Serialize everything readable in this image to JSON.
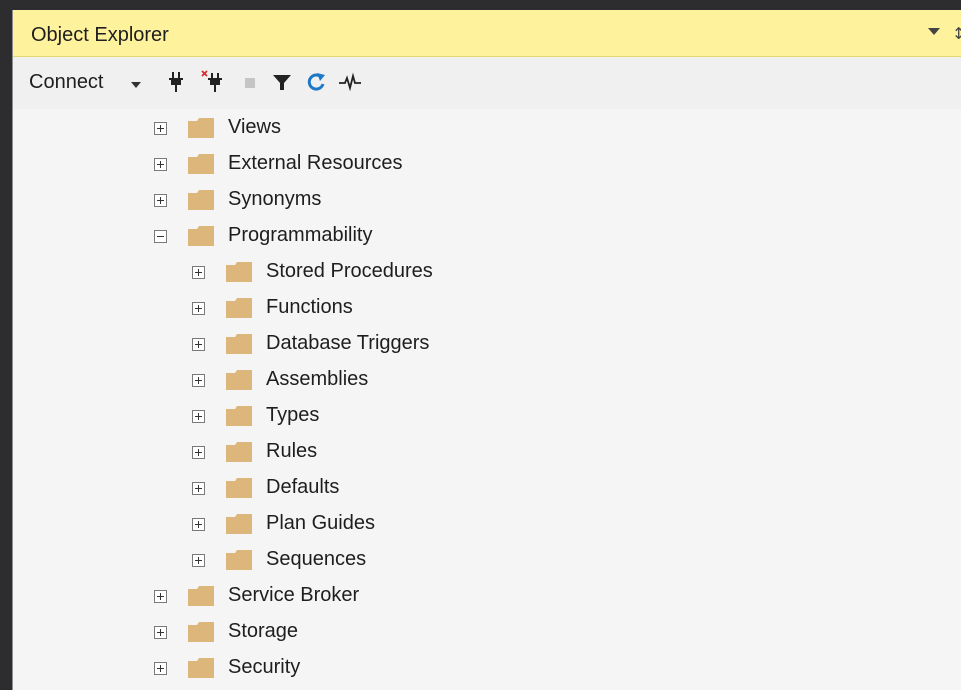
{
  "window": {
    "title": "Object Explorer"
  },
  "toolbar": {
    "connect_label": "Connect",
    "icons": [
      "connect-plug-icon",
      "disconnect-plug-icon",
      "stop-icon",
      "filter-icon",
      "refresh-icon",
      "activity-monitor-icon"
    ]
  },
  "colors": {
    "title_bg": "#fff29d",
    "folder": "#dcb67a",
    "refresh": "#1e78c8"
  },
  "tree": {
    "views": "Views",
    "external_resources": "External Resources",
    "synonyms": "Synonyms",
    "programmability": "Programmability",
    "stored_procedures": "Stored Procedures",
    "functions": "Functions",
    "database_triggers": "Database Triggers",
    "assemblies": "Assemblies",
    "types": "Types",
    "rules": "Rules",
    "defaults": "Defaults",
    "plan_guides": "Plan Guides",
    "sequences": "Sequences",
    "service_broker": "Service Broker",
    "storage": "Storage",
    "security": "Security"
  }
}
